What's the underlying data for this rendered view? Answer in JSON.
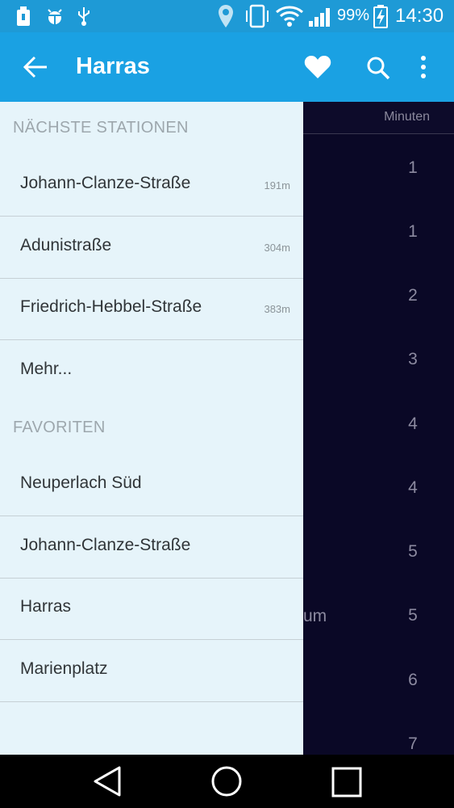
{
  "status_bar": {
    "battery_percent": "99%",
    "time": "14:30"
  },
  "app_bar": {
    "title": "Harras"
  },
  "main": {
    "column_header": "Minuten",
    "minutes": [
      "1",
      "1",
      "2",
      "3",
      "4",
      "4",
      "5",
      "5",
      "6",
      "7"
    ],
    "partial_text": "um"
  },
  "drawer": {
    "nearest_header": "NÄCHSTE STATIONEN",
    "nearest": [
      {
        "name": "Johann-Clanze-Straße",
        "distance": "191m"
      },
      {
        "name": "Adunistraße",
        "distance": "304m"
      },
      {
        "name": "Friedrich-Hebbel-Straße",
        "distance": "383m"
      }
    ],
    "more_label": "Mehr...",
    "favorites_header": "FAVORITEN",
    "favorites": [
      {
        "name": "Neuperlach Süd"
      },
      {
        "name": "Johann-Clanze-Straße"
      },
      {
        "name": "Harras"
      },
      {
        "name": "Marienplatz"
      }
    ]
  },
  "colors": {
    "status_bar": "#1e9ad6",
    "app_bar": "#1aa1e3",
    "drawer_bg": "#e6f4fa",
    "main_bg": "#0a0826"
  }
}
